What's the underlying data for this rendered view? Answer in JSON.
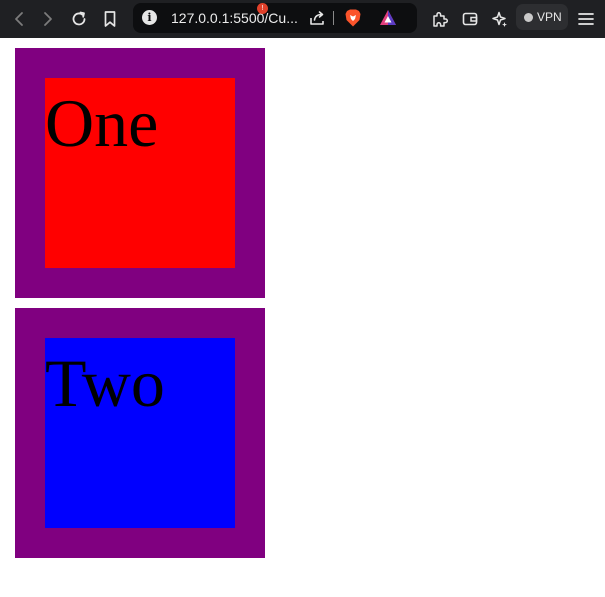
{
  "browser": {
    "url": "127.0.0.1:5500/Cu...",
    "info_glyph": "i",
    "rewards_badge": "!",
    "vpn_label": "VPN",
    "icons": [
      "back-icon",
      "forward-icon",
      "reload-icon",
      "bookmark-icon",
      "info-icon",
      "share-icon",
      "brave-shields-icon",
      "brave-rewards-icon",
      "extensions-icon",
      "wallet-icon",
      "leo-ai-icon",
      "menu-icon"
    ]
  },
  "boxes": [
    {
      "label": "One",
      "inner_color": "#ff0000",
      "outer_color": "#800080"
    },
    {
      "label": "Two",
      "inner_color": "#0000ff",
      "outer_color": "#800080"
    }
  ]
}
